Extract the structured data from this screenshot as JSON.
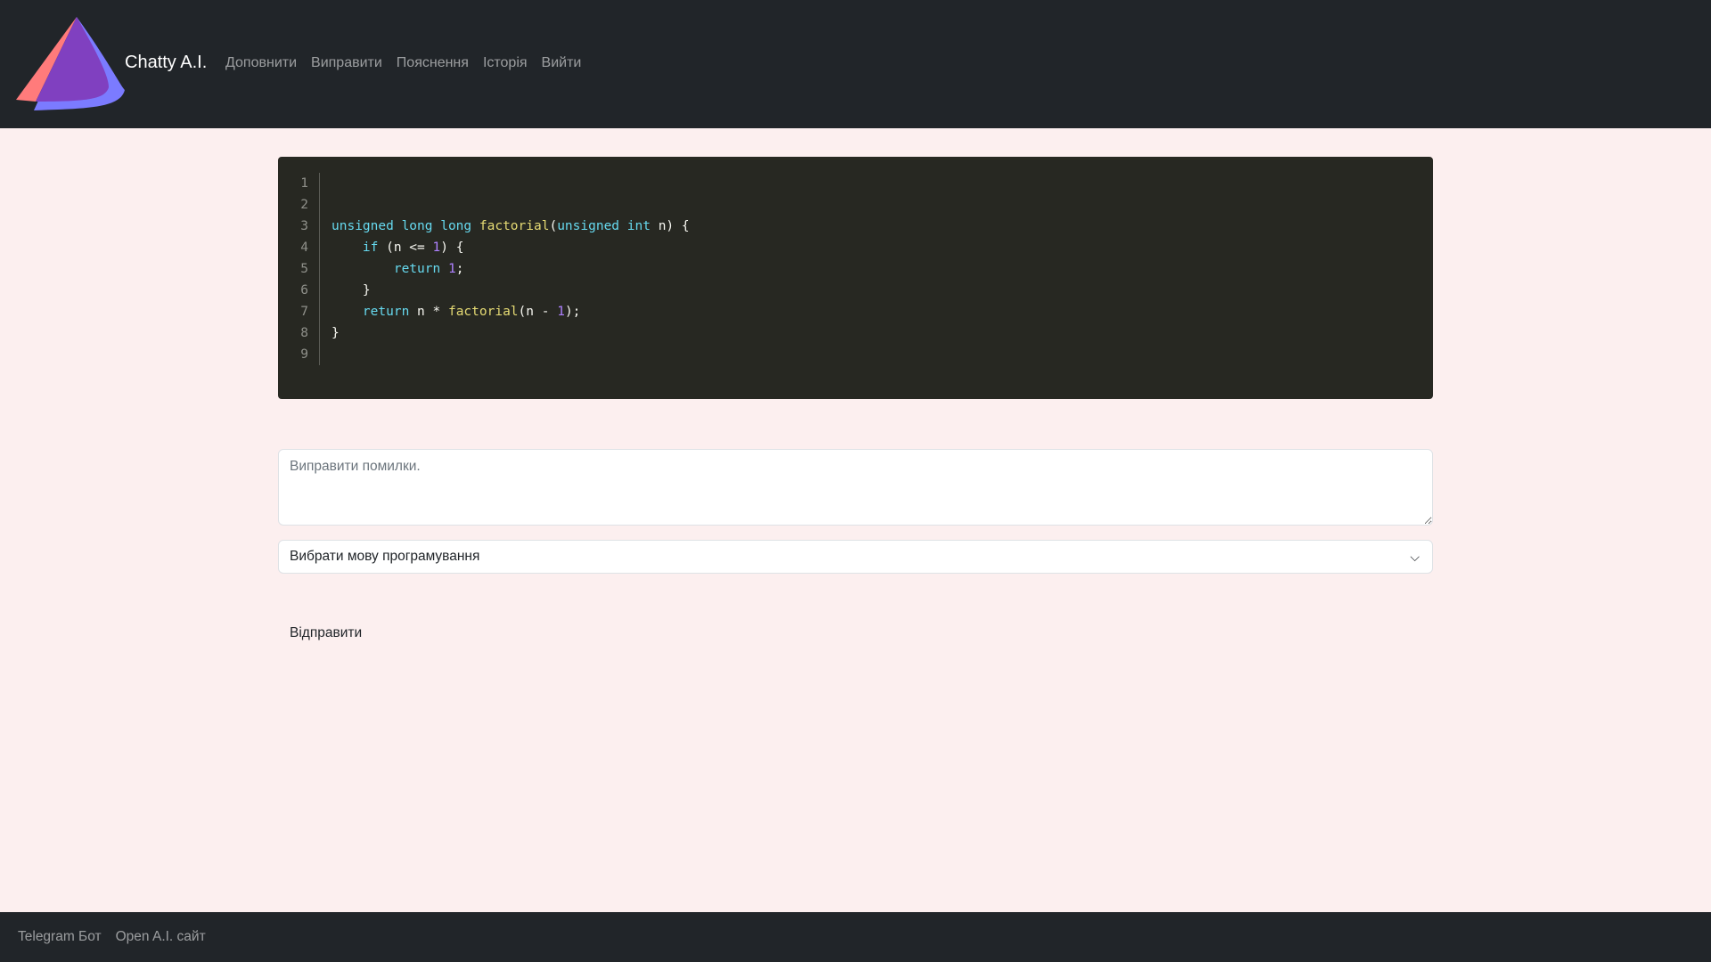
{
  "header": {
    "brand": "Chatty A.I.",
    "nav": [
      "Доповнити",
      "Виправити",
      "Пояснення",
      "Історія",
      "Вийти"
    ]
  },
  "code": {
    "lines": [
      {
        "n": "1",
        "tokens": []
      },
      {
        "n": "2",
        "tokens": []
      },
      {
        "n": "3",
        "tokens": [
          [
            "k",
            "unsigned long long "
          ],
          [
            "f",
            "factorial"
          ],
          [
            "",
            "("
          ],
          [
            "k",
            "unsigned int "
          ],
          [
            "",
            "n) {"
          ]
        ]
      },
      {
        "n": "4",
        "tokens": [
          [
            "",
            "    "
          ],
          [
            "k",
            "if"
          ],
          [
            "",
            " (n <= "
          ],
          [
            "n",
            "1"
          ],
          [
            "",
            ") {"
          ]
        ]
      },
      {
        "n": "5",
        "tokens": [
          [
            "",
            "        "
          ],
          [
            "k",
            "return "
          ],
          [
            "n",
            "1"
          ],
          [
            "",
            ";"
          ]
        ]
      },
      {
        "n": "6",
        "tokens": [
          [
            "",
            "    }"
          ]
        ]
      },
      {
        "n": "7",
        "tokens": [
          [
            "",
            "    "
          ],
          [
            "k",
            "return"
          ],
          [
            "",
            " n * "
          ],
          [
            "f",
            "factorial"
          ],
          [
            "",
            "(n - "
          ],
          [
            "n",
            "1"
          ],
          [
            "",
            ");"
          ]
        ]
      },
      {
        "n": "8",
        "tokens": [
          [
            "",
            "}"
          ]
        ]
      },
      {
        "n": "9",
        "tokens": []
      }
    ],
    "colors": {
      "background": "#272822",
      "keyword": "#66d9ef",
      "function": "#e6db74",
      "number": "#ae81ff"
    }
  },
  "form": {
    "prompt_placeholder": "Виправити помилки.",
    "language_select": "Вибрати мову програмування",
    "send": "Відправити"
  },
  "footer": {
    "links": [
      "Telegram Бот",
      "Open A.I. сайт"
    ]
  }
}
